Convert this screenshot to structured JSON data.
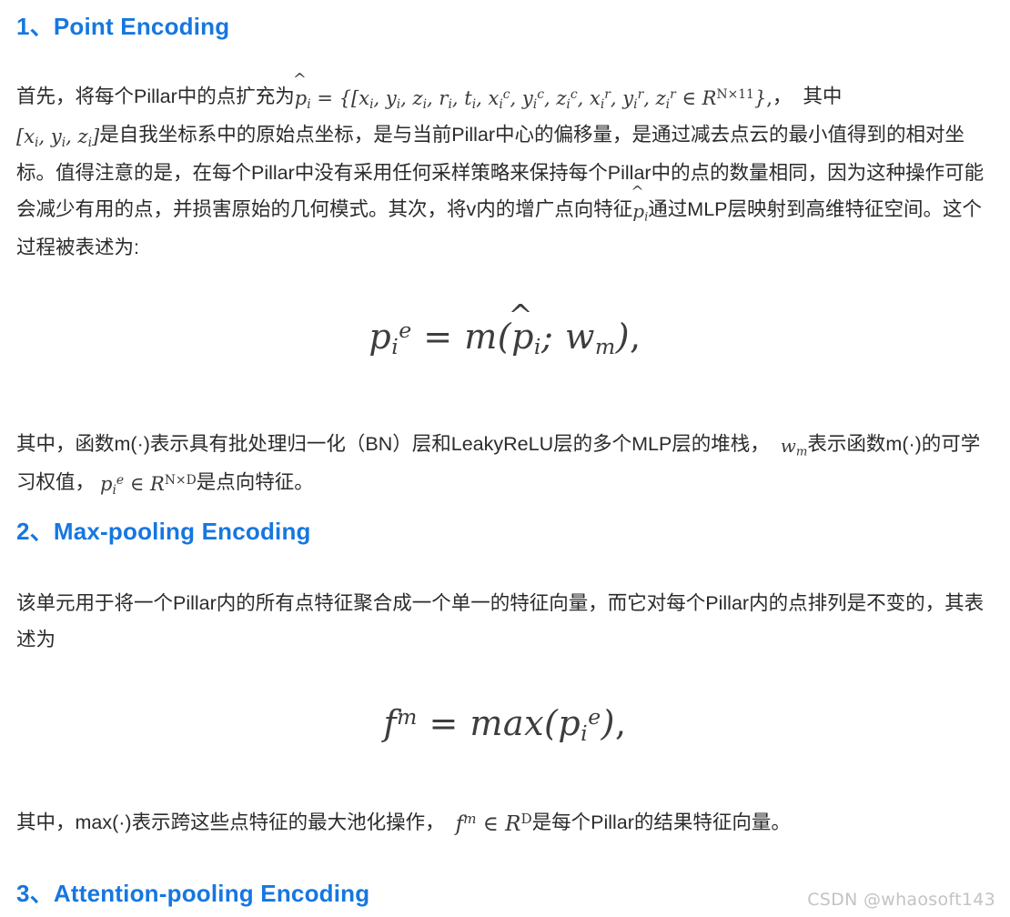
{
  "document": {
    "background_color": "#ffffff",
    "text_color": "#2b2b2b",
    "heading_color": "#1677e0",
    "watermark_color": "#c3c3c3"
  },
  "sections": [
    {
      "number": "1、",
      "title": "Point Encoding"
    },
    {
      "number": "2、",
      "title": "Max-pooling Encoding"
    },
    {
      "number": "3、",
      "title": "Attention-pooling Encoding"
    }
  ],
  "paragraphs": {
    "p1": {
      "t1": "首先，将每个Pillar中的点扩充为",
      "t2": "，",
      "t3": "其中",
      "t4": "是自我坐标系中的原始点坐标，是与当前Pillar中心的偏移量，是通过减去点云的最小值得到的相对坐标。值得注意的是，在每个Pillar中没有采用任何采样策略来保持每个Pillar中的点的数量相同，因为这种操作可能会减少有用的点，并损害原始的几何模式。其次，将v内的增广点向特征",
      "t5": "通过MLP层映射到高维特征空间。这个过程被表述为:"
    },
    "p2": {
      "t1": "其中，函数m(·)表示具有批处理归一化（BN）层和LeakyReLU层的多个MLP层的堆栈，",
      "t2": "表示函数m(·)的可学习权值，",
      "t3": "是点向特征。"
    },
    "p3": {
      "t1": "该单元用于将一个Pillar内的所有点特征聚合成一个单一的特征向量，而它对每个Pillar内的点排列是不变的，其表述为"
    },
    "p4": {
      "t1": "其中，max(·)表示跨这些点特征的最大池化操作，",
      "t2": "是每个Pillar的结果特征向量。"
    }
  },
  "math": {
    "p_hat_def": "p̂ᵢ = {[xᵢ, yᵢ, zᵢ, rᵢ, tᵢ, xᵢᶜ, yᵢᶜ, zᵢᶜ, xᵢʳ, yᵢʳ, zᵢʳ ∈ R^{N×11}},",
    "xyz_bracket": "[xᵢ, yᵢ, zᵢ]",
    "p_hat": "p̂ᵢ",
    "w_m": "wₘ",
    "pe_in_R": "pᵢᵉ ∈ R^{N×D}",
    "fm_in_R": "fᵐ ∈ R^{D}",
    "equation_1": "pᵢᵉ = m(p̂ᵢ; wₘ),",
    "equation_2": "fᵐ = max(pᵢᵉ),"
  },
  "watermark": {
    "text": "CSDN @whaosoft143"
  }
}
